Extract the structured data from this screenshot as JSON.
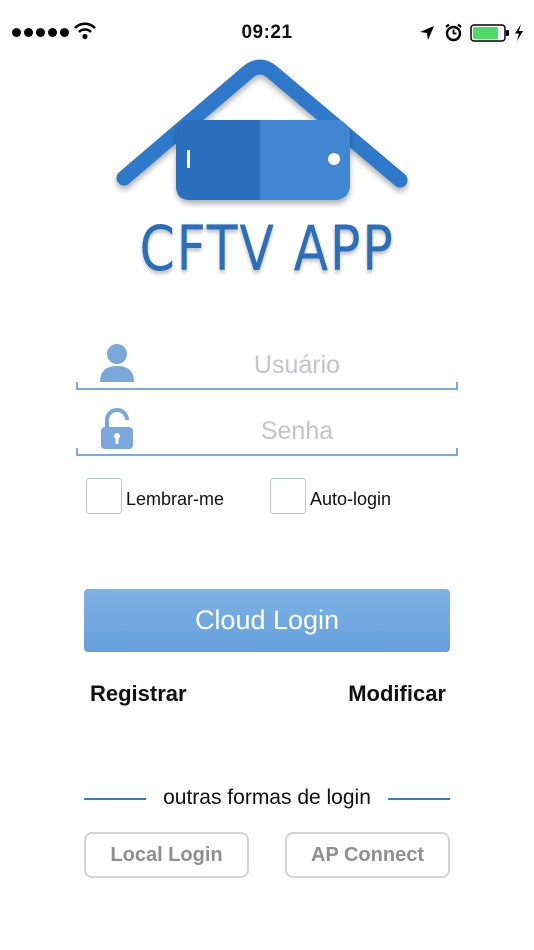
{
  "status_bar": {
    "time": "09:21",
    "battery_color": "#4cd964",
    "icons": [
      "signal-dots-icon",
      "wifi-icon",
      "location-arrow-icon",
      "alarm-icon",
      "battery-icon",
      "charging-bolt-icon"
    ]
  },
  "logo": {
    "text": "CFTV APP",
    "brand_color": "#2a6fbe",
    "accent_color": "#4a90d9"
  },
  "login_form": {
    "username": {
      "value": "",
      "placeholder": "Usuário",
      "icon": "user-icon"
    },
    "password": {
      "value": "",
      "placeholder": "Senha",
      "icon": "padlock-icon"
    },
    "remember_me": {
      "label": "Lembrar-me",
      "checked": false
    },
    "auto_login": {
      "label": "Auto-login",
      "checked": false
    }
  },
  "actions": {
    "cloud_login": "Cloud Login",
    "register": "Registrar",
    "modify": "Modificar"
  },
  "other_logins": {
    "divider_text": "outras formas de login",
    "local_login": "Local Login",
    "ap_connect": "AP Connect"
  },
  "colors": {
    "primary_button": "#72a9e1",
    "underline": "#7fa9d9",
    "divider_line": "#3b78c4",
    "placeholder": "#c4c4c8"
  }
}
